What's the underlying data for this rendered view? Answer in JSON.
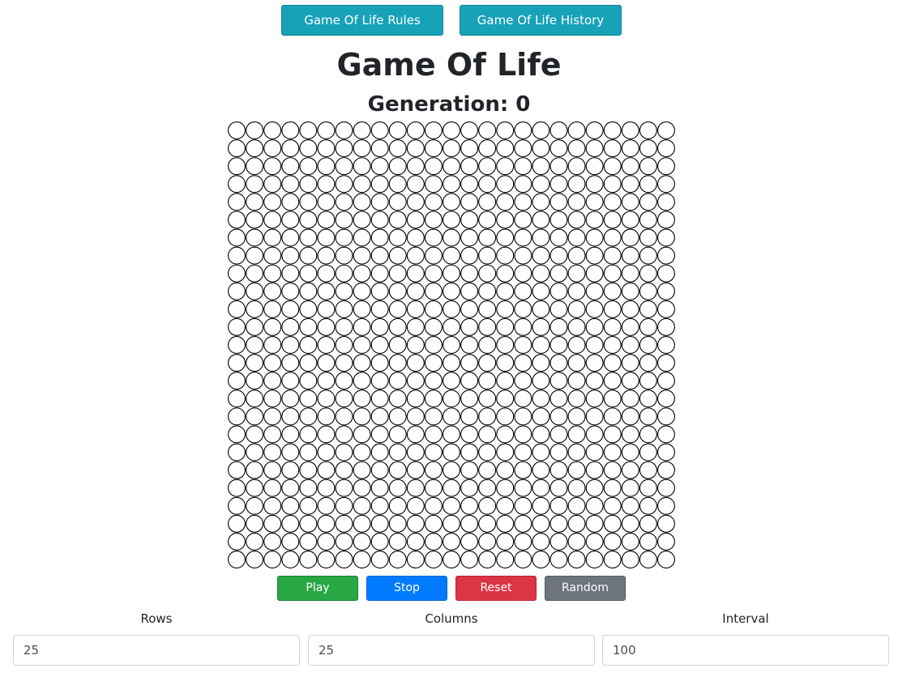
{
  "header": {
    "rules_button": "Game Of Life Rules",
    "history_button": "Game Of Life History",
    "title": "Game Of Life",
    "generation_label": "Generation: ",
    "generation_value": "0"
  },
  "grid": {
    "rows": 25,
    "columns": 25,
    "cell_fill": "#ffffff",
    "cell_stroke": "#000000"
  },
  "controls": {
    "play": "Play",
    "stop": "Stop",
    "reset": "Reset",
    "random": "Random"
  },
  "settings": {
    "rows_label": "Rows",
    "rows_value": "25",
    "columns_label": "Columns",
    "columns_value": "25",
    "interval_label": "Interval",
    "interval_value": "100"
  },
  "colors": {
    "info": "#17a2b8",
    "success": "#28a745",
    "primary": "#007bff",
    "danger": "#dc3545",
    "secondary": "#6c757d"
  }
}
